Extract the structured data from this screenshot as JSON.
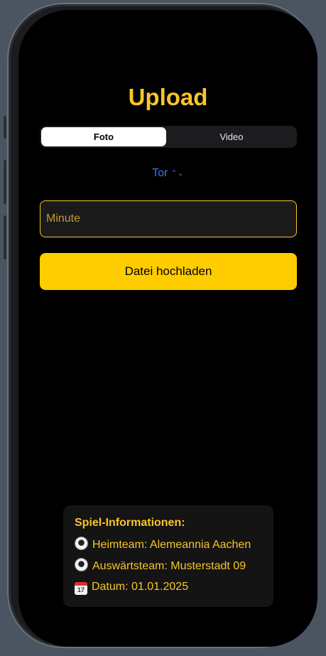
{
  "page": {
    "title": "Upload"
  },
  "segmented": {
    "options": [
      "Foto",
      "Video"
    ],
    "selected": "Foto"
  },
  "picker": {
    "value": "Tor"
  },
  "minute_field": {
    "placeholder": "Minute",
    "value": ""
  },
  "upload_button": {
    "label": "Datei hochladen"
  },
  "info": {
    "heading": "Spiel-Informationen:",
    "home_team": "Heimteam: Alemeannia Aachen",
    "away_team": "Auswärtsteam: Musterstadt 09",
    "date": "Datum: 01.01.2025",
    "calendar_day": "17"
  },
  "colors": {
    "accent": "#f8c52a",
    "button": "#ffcc00",
    "link": "#3478f6",
    "background": "#000000"
  },
  "icons": {
    "home": "soccer-ball-icon",
    "away": "soccer-ball-icon",
    "date": "calendar-icon",
    "picker": "chevron-up-down-icon"
  }
}
